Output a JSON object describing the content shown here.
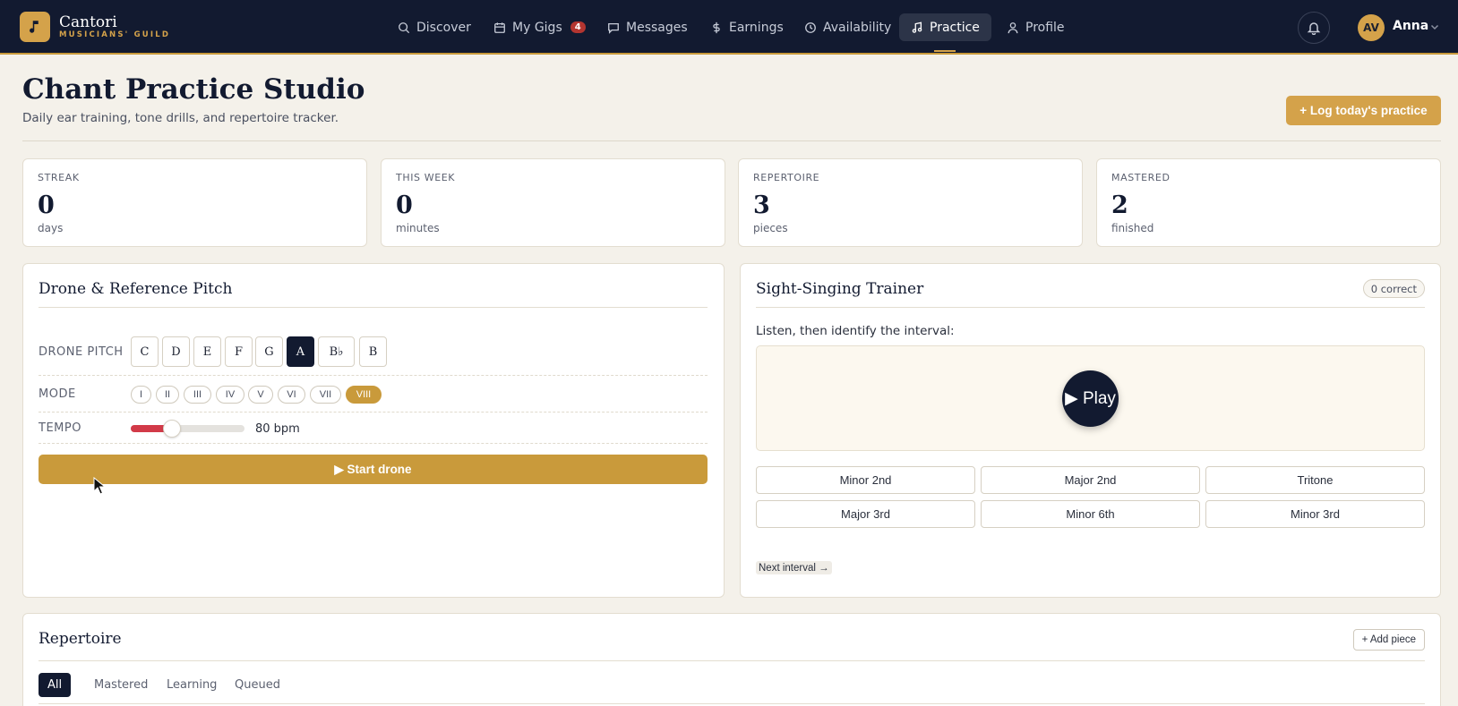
{
  "brand": {
    "name": "Cantori",
    "subtitle": "MUSICIANS' GUILD",
    "accent": "#d4a24a",
    "nav_bg": "#121a30"
  },
  "nav": {
    "items": [
      {
        "label": "Discover",
        "icon": "search-icon"
      },
      {
        "label": "My Gigs",
        "icon": "calendar-icon",
        "badge": "4"
      },
      {
        "label": "Messages",
        "icon": "message-icon"
      },
      {
        "label": "Earnings",
        "icon": "dollar-icon"
      },
      {
        "label": "Availability",
        "icon": "clock-icon"
      },
      {
        "label": "Practice",
        "icon": "music-note-icon",
        "active": true
      },
      {
        "label": "Profile",
        "icon": "user-icon"
      }
    ],
    "user": {
      "initials": "AV",
      "name": "Anna"
    }
  },
  "header": {
    "title": "Chant Practice Studio",
    "subtitle": "Daily ear training, tone drills, and repertoire tracker.",
    "log_button": "+ Log today's practice"
  },
  "stats": [
    {
      "label": "STREAK",
      "value": "0",
      "unit": "days"
    },
    {
      "label": "THIS WEEK",
      "value": "0",
      "unit": "minutes"
    },
    {
      "label": "REPERTOIRE",
      "value": "3",
      "unit": "pieces"
    },
    {
      "label": "MASTERED",
      "value": "2",
      "unit": "finished"
    }
  ],
  "drone": {
    "title": "Drone & Reference Pitch",
    "pitch_label": "DRONE PITCH",
    "pitches": [
      "C",
      "D",
      "E",
      "F",
      "G",
      "A",
      "B♭",
      "B"
    ],
    "selected_pitch": "A",
    "mode_label": "MODE",
    "modes": [
      "I",
      "II",
      "III",
      "IV",
      "V",
      "VI",
      "VII",
      "VIII"
    ],
    "selected_mode": "VIII",
    "tempo_label": "TEMPO",
    "tempo_value": "80 bpm",
    "tempo_fraction": 0.36,
    "start_button": "▶ Start drone"
  },
  "trainer": {
    "title": "Sight-Singing Trainer",
    "correct_badge": "0 correct",
    "instruction": "Listen, then identify the interval:",
    "play_button": "▶ Play",
    "intervals": [
      "Minor 2nd",
      "Major 2nd",
      "Tritone",
      "Major 3rd",
      "Minor 6th",
      "Minor 3rd"
    ],
    "next_button": "Next interval →"
  },
  "repertoire": {
    "title": "Repertoire",
    "add_button": "+ Add piece",
    "tabs": [
      "All",
      "Mastered",
      "Learning",
      "Queued"
    ],
    "active_tab": "All"
  }
}
